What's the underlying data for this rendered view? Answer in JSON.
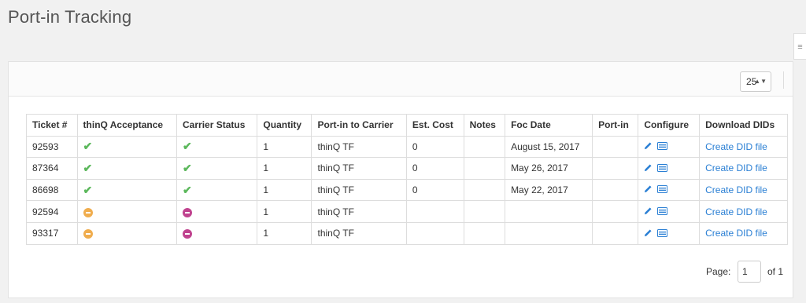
{
  "page": {
    "title": "Port-in Tracking"
  },
  "side_tab": {
    "glyph": "≡"
  },
  "toolbar": {
    "page_size": "25",
    "page_size_arrows": "▲▼"
  },
  "table": {
    "headers": [
      "Ticket #",
      "thinQ Acceptance",
      "Carrier Status",
      "Quantity",
      "Port-in to Carrier",
      "Est. Cost",
      "Notes",
      "Foc Date",
      "Port-in",
      "Configure",
      "Download DIDs"
    ],
    "rows": [
      {
        "ticket": "92593",
        "acceptance": "check",
        "carrier_status": "check",
        "quantity": "1",
        "carrier": "thinQ TF",
        "est_cost": "0",
        "notes": "",
        "foc_date": "August 15, 2017",
        "port_in": "",
        "download": "Create DID file"
      },
      {
        "ticket": "87364",
        "acceptance": "check",
        "carrier_status": "check",
        "quantity": "1",
        "carrier": "thinQ TF",
        "est_cost": "0",
        "notes": "",
        "foc_date": "May 26, 2017",
        "port_in": "",
        "download": "Create DID file"
      },
      {
        "ticket": "86698",
        "acceptance": "check",
        "carrier_status": "check",
        "quantity": "1",
        "carrier": "thinQ TF",
        "est_cost": "0",
        "notes": "",
        "foc_date": "May 22, 2017",
        "port_in": "",
        "download": "Create DID file"
      },
      {
        "ticket": "92594",
        "acceptance": "pending",
        "carrier_status": "blocked",
        "quantity": "1",
        "carrier": "thinQ TF",
        "est_cost": "",
        "notes": "",
        "foc_date": "",
        "port_in": "",
        "download": "Create DID file"
      },
      {
        "ticket": "93317",
        "acceptance": "pending",
        "carrier_status": "blocked",
        "quantity": "1",
        "carrier": "thinQ TF",
        "est_cost": "",
        "notes": "",
        "foc_date": "",
        "port_in": "",
        "download": "Create DID file"
      }
    ]
  },
  "pagination": {
    "label": "Page:",
    "current": "1",
    "of_text": "of 1"
  },
  "colors": {
    "check": "#5cb85c",
    "pending": "#f0ad4e",
    "blocked": "#c0438f",
    "link": "#2a7fd4"
  },
  "icons": {
    "check": "check-icon",
    "pending": "minus-circle-orange-icon",
    "blocked": "minus-circle-purple-icon",
    "edit": "pencil-icon",
    "view": "card-icon"
  }
}
